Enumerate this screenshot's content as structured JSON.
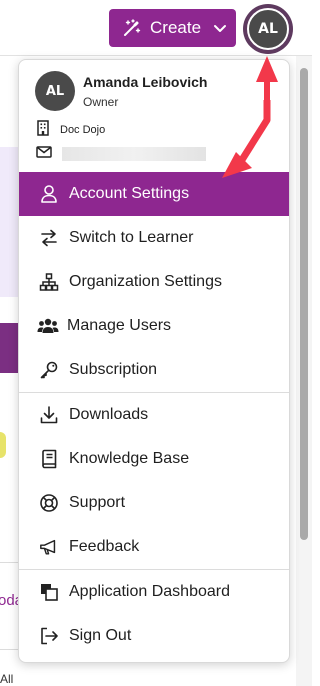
{
  "header": {
    "create_label": "Create",
    "avatar_initials": "AL"
  },
  "profile": {
    "initials": "AL",
    "name": "Amanda Leibovich",
    "role": "Owner",
    "organization": "Doc Dojo",
    "email": ""
  },
  "menu": {
    "items": [
      {
        "label": "Account Settings",
        "icon": "user-icon",
        "active": true
      },
      {
        "label": "Switch to Learner",
        "icon": "swap-arrows-icon"
      },
      {
        "label": "Organization Settings",
        "icon": "org-chart-icon"
      },
      {
        "label": "Manage Users",
        "icon": "users-icon"
      },
      {
        "label": "Subscription",
        "icon": "key-icon"
      },
      {
        "label": "Downloads",
        "icon": "download-icon"
      },
      {
        "label": "Knowledge Base",
        "icon": "book-icon"
      },
      {
        "label": "Support",
        "icon": "lifebuoy-icon"
      },
      {
        "label": "Feedback",
        "icon": "megaphone-icon"
      },
      {
        "label": "Application Dashboard",
        "icon": "copy-icon"
      },
      {
        "label": "Sign Out",
        "icon": "sign-out-icon"
      }
    ]
  },
  "background": {
    "partial_text_1": "oda",
    "partial_text_2": "All"
  },
  "colors": {
    "brand": "#8e2790",
    "annotation_arrow": "#f2384a"
  }
}
